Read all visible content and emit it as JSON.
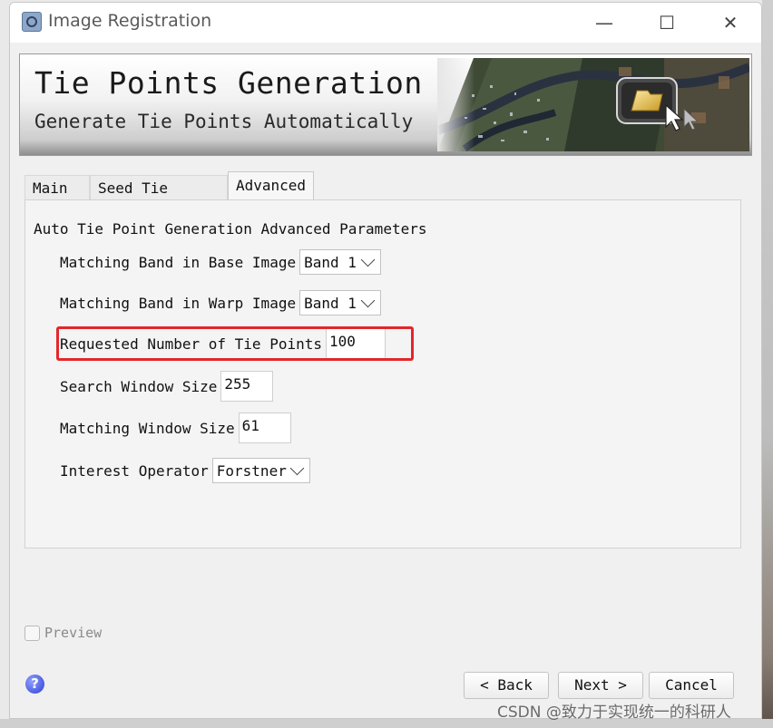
{
  "window": {
    "title": "Image Registration",
    "controls": {
      "minimize": "—",
      "maximize": "☐",
      "close": "✕"
    }
  },
  "banner": {
    "title": "Tie Points Generation",
    "subtitle": "Generate Tie Points Automatically"
  },
  "tabs": [
    {
      "label": "Main",
      "active": false
    },
    {
      "label": "Seed Tie Points",
      "active": false
    },
    {
      "label": "Advanced",
      "active": true
    }
  ],
  "advanced": {
    "section_title": "Auto Tie Point Generation Advanced Parameters",
    "matching_band_base": {
      "label": "Matching Band in Base Image",
      "value": "Band 1"
    },
    "matching_band_warp": {
      "label": "Matching Band in Warp Image",
      "value": "Band 1"
    },
    "requested_tie_points": {
      "label": "Requested Number of Tie Points",
      "value": "100"
    },
    "search_window": {
      "label": "Search Window Size",
      "value": "255"
    },
    "matching_window": {
      "label": "Matching Window Size",
      "value": "61"
    },
    "interest_operator": {
      "label": "Interest Operator",
      "value": "Forstner"
    }
  },
  "preview": {
    "label": "Preview",
    "checked": false
  },
  "footer": {
    "help": "?",
    "back_label": "< Back",
    "next_label": "Next >",
    "cancel_label": "Cancel"
  },
  "watermark": "CSDN @致力于实现统一的科研人",
  "colors": {
    "highlight": "#e3262b",
    "help_icon": "#2f3fd0"
  }
}
